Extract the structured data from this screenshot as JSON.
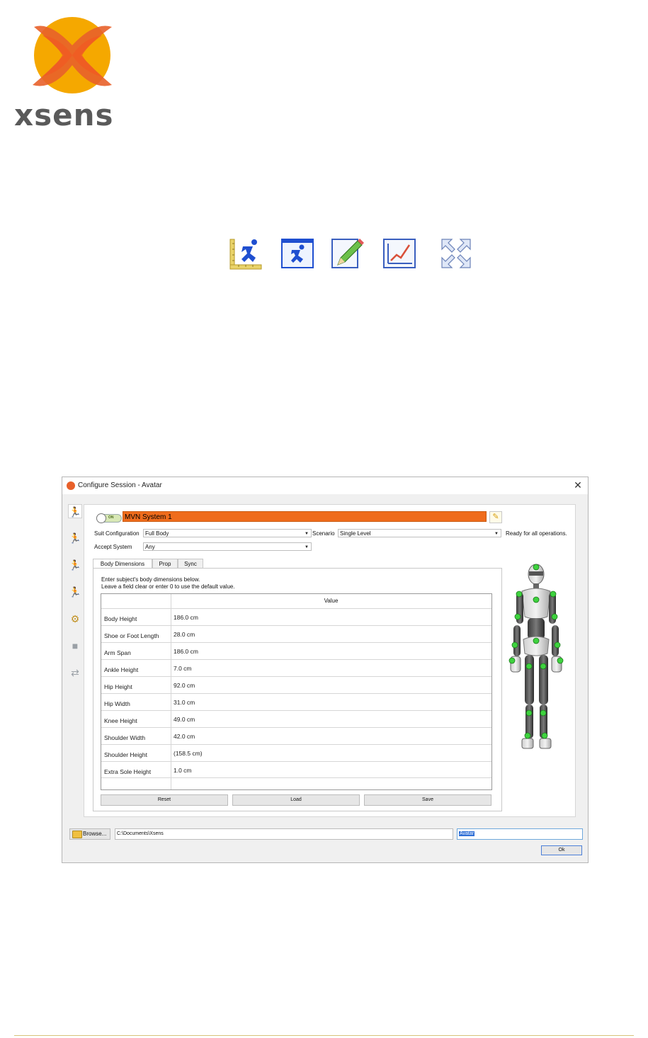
{
  "brand": {
    "wordmark": "xsens",
    "accent": "#f5a800"
  },
  "toolbar": {
    "icons": [
      "body-dimensions-icon",
      "avatar-window-icon",
      "pencil-edit-icon",
      "line-graph-icon",
      "expand-arrows-icon"
    ]
  },
  "dialog": {
    "title": "Configure Session - Avatar",
    "close": "✕",
    "system_name": "MVN System 1",
    "toggle_label": "ON",
    "suit_configuration_label": "Suit Configuration",
    "suit_configuration_value": "Full Body",
    "scenario_label": "Scenario",
    "scenario_value": "Single Level",
    "accept_system_label": "Accept System",
    "accept_system_value": "Any",
    "status": "Ready for all operations.",
    "tabs": [
      "Body Dimensions",
      "Prop",
      "Sync"
    ],
    "instruction_line1": "Enter subject's body dimensions below.",
    "instruction_line2": "Leave a field clear or enter 0 to use the default value.",
    "table_header": "Value",
    "rows": [
      {
        "label": "Body Height",
        "value": "186.0 cm"
      },
      {
        "label": "Shoe or Foot Length",
        "value": "28.0 cm"
      },
      {
        "label": "Arm Span",
        "value": "186.0 cm"
      },
      {
        "label": "Ankle Height",
        "value": "7.0 cm"
      },
      {
        "label": "Hip Height",
        "value": "92.0 cm"
      },
      {
        "label": "Hip Width",
        "value": "31.0 cm"
      },
      {
        "label": "Knee Height",
        "value": "49.0 cm"
      },
      {
        "label": "Shoulder Width",
        "value": "42.0 cm"
      },
      {
        "label": "Shoulder Height",
        "value": "(158.5 cm)"
      },
      {
        "label": "Extra Sole Height",
        "value": "1.0 cm"
      }
    ],
    "buttons": {
      "reset": "Reset",
      "load": "Load",
      "save": "Save"
    },
    "browse_label": "Browse...",
    "path": "C:\\Documents\\Xsens",
    "file_name": "Avatar",
    "ok": "Ok"
  }
}
